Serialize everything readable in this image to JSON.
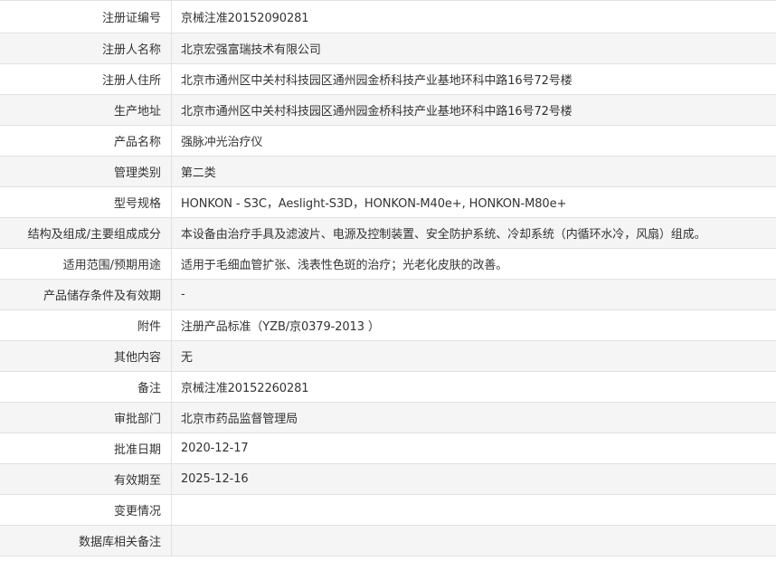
{
  "rows": [
    {
      "label": "注册证编号",
      "value": "京械注准20152090281"
    },
    {
      "label": "注册人名称",
      "value": "北京宏强富瑞技术有限公司"
    },
    {
      "label": "注册人住所",
      "value": "北京市通州区中关村科技园区通州园金桥科技产业基地环科中路16号72号楼"
    },
    {
      "label": "生产地址",
      "value": "北京市通州区中关村科技园区通州园金桥科技产业基地环科中路16号72号楼"
    },
    {
      "label": "产品名称",
      "value": "强脉冲光治疗仪"
    },
    {
      "label": "管理类别",
      "value": "第二类"
    },
    {
      "label": "型号规格",
      "value": "HONKON - S3C，Aeslight-S3D，HONKON-M40e+, HONKON-M80e+"
    },
    {
      "label": "结构及组成/主要组成成分",
      "value": "本设备由治疗手具及滤波片、电源及控制装置、安全防护系统、冷却系统（内循环水冷，风扇）组成。"
    },
    {
      "label": "适用范围/预期用途",
      "value": "适用于毛细血管扩张、浅表性色斑的治疗；光老化皮肤的改善。"
    },
    {
      "label": "产品储存条件及有效期",
      "value": "-"
    },
    {
      "label": "附件",
      "value": "注册产品标准（YZB/京0379-2013 ）"
    },
    {
      "label": "其他内容",
      "value": "无"
    },
    {
      "label": "备注",
      "value": "京械注准20152260281"
    },
    {
      "label": "审批部门",
      "value": "北京市药品监督管理局"
    },
    {
      "label": "批准日期",
      "value": "2020-12-17"
    },
    {
      "label": "有效期至",
      "value": "2025-12-16"
    },
    {
      "label": "变更情况",
      "value": ""
    },
    {
      "label": "数据库相关备注",
      "value": ""
    }
  ]
}
